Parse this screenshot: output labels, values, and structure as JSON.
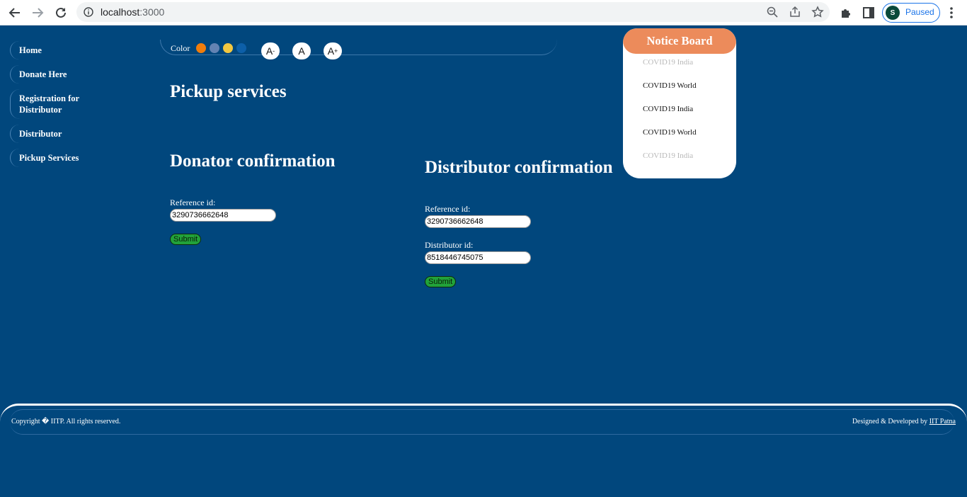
{
  "browser": {
    "url_host": "localhost",
    "url_port": ":3000",
    "profile_initial": "S",
    "profile_status": "Paused"
  },
  "sidebar": {
    "items": [
      {
        "label": "Home"
      },
      {
        "label": "Donate Here"
      },
      {
        "label": "Registration for Distributor"
      },
      {
        "label": "Distributor"
      },
      {
        "label": "Pickup Services"
      }
    ]
  },
  "toolbar": {
    "color_label": "Color",
    "swatches": [
      "#f07d0c",
      "#6383b3",
      "#f2c740",
      "#0d5fa8"
    ],
    "decrease_label": "A",
    "decrease_sub": "-",
    "reset_label": "A",
    "increase_label": "A",
    "increase_sub": "+"
  },
  "main": {
    "title": "Pickup services",
    "donator": {
      "title": "Donator confirmation",
      "reference_label": "Reference id:",
      "reference_value": "3290736662648",
      "submit_label": "Submit"
    },
    "distributor": {
      "title": "Distributor confirmation",
      "reference_label": "Reference id:",
      "reference_value": "3290736662648",
      "distributor_label": "Distributor id:",
      "distributor_value": "8518446745075",
      "submit_label": "Submit"
    }
  },
  "notice_board": {
    "title": "Notice Board",
    "items": [
      "COVID19 India",
      "COVID19 World",
      "COVID19 India",
      "COVID19 World",
      "COVID19 India"
    ]
  },
  "footer": {
    "copyright": "Copyright � IITP. All rights reserved.",
    "credit_prefix": "Designed & Developed by",
    "credit_link": "IIT Patna"
  }
}
